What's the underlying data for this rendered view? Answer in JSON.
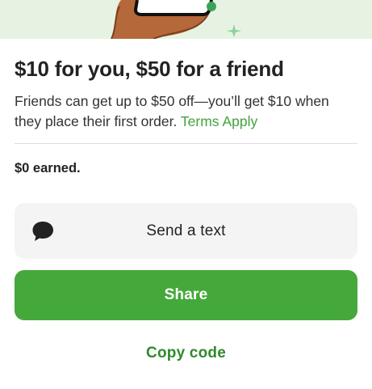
{
  "referral": {
    "title": "$10 for you, $50 for a friend",
    "description": "Friends can get up to $50 off—you’ll get $10 when they place their first order.",
    "terms_link": "Terms Apply",
    "earned": "$0 earned."
  },
  "actions": {
    "send_text_label": "Send a text",
    "send_text_icon": "chat-bubble-icon",
    "share_label": "Share",
    "copy_code_label": "Copy code"
  },
  "colors": {
    "primary_green": "#45a83a",
    "link_green": "#43a33d",
    "hero_background": "#e7f3e2"
  }
}
